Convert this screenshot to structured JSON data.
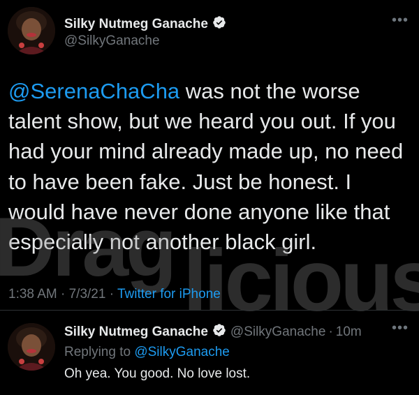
{
  "tweet": {
    "display_name": "Silky Nutmeg Ganache",
    "handle": "@SilkyGanache",
    "more_label": "•••",
    "body_mention": "@SerenaChaCha",
    "body_text": " was not the worse talent show, but we heard you out. If you had your mind already made up, no need to have been fake. Just be honest. I would have never done anyone like that especially not another black girl.",
    "time": "1:38 AM",
    "date": "7/3/21",
    "app": "Twitter for iPhone",
    "separator": "·"
  },
  "reply": {
    "display_name": "Silky Nutmeg Ganache",
    "handle": "@SilkyGanache",
    "age": "10m",
    "separator": "·",
    "more_label": "•••",
    "replying_prefix": "Replying to",
    "replying_to": "@SilkyGanache",
    "text": "Oh yea. You good. No love lost."
  },
  "watermark": {
    "text": "Draglicious"
  },
  "colors": {
    "background": "#000000",
    "accent": "#1d9bf0",
    "muted": "#71767b"
  }
}
